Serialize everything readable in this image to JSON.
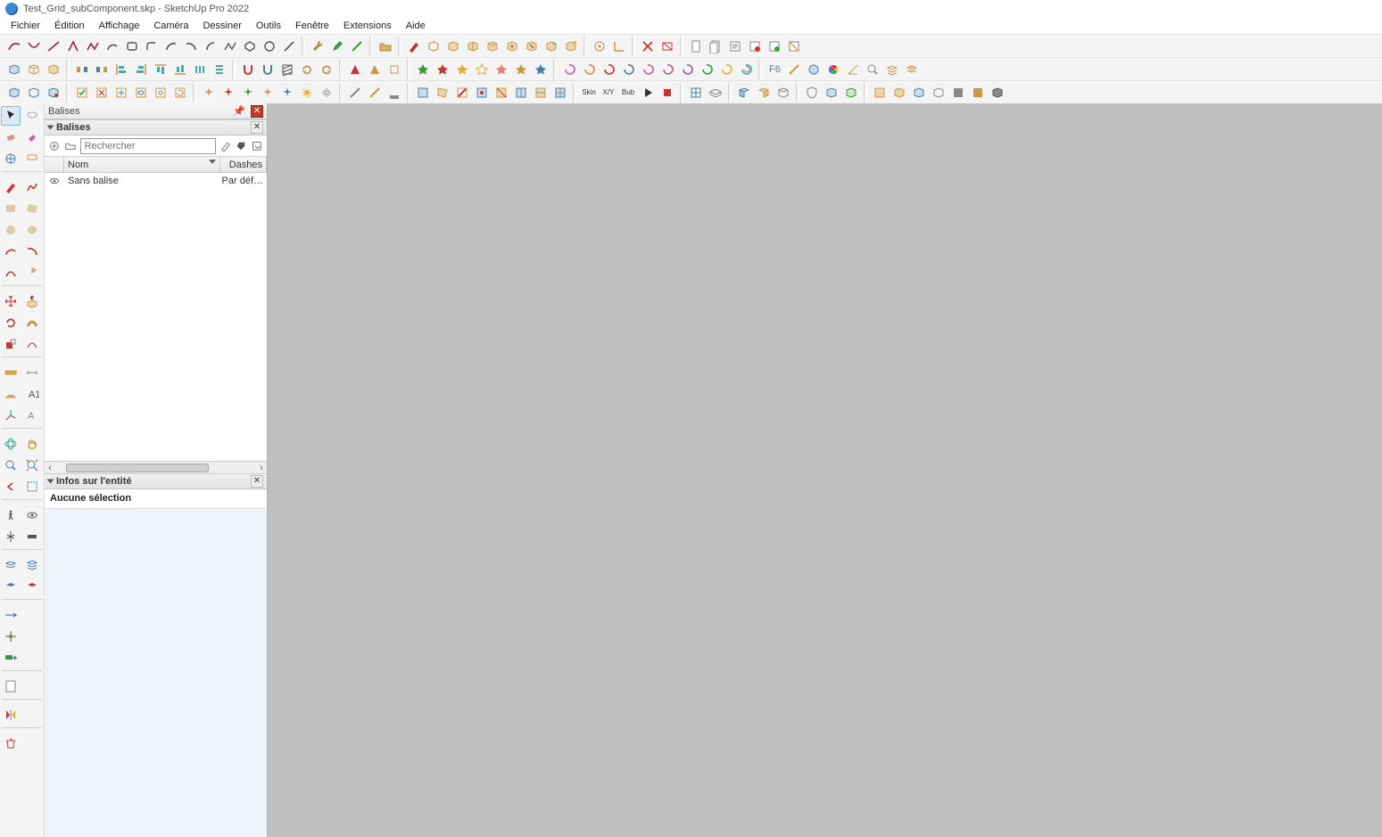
{
  "titlebar": {
    "title": "Test_Grid_subComponent.skp - SketchUp Pro 2022"
  },
  "menu": [
    "Fichier",
    "Édition",
    "Affichage",
    "Caméra",
    "Dessiner",
    "Outils",
    "Fenêtre",
    "Extensions",
    "Aide"
  ],
  "dock": {
    "title": "Balises"
  },
  "panels": {
    "tags": {
      "title": "Balises",
      "search_placeholder": "Rechercher",
      "cols": {
        "name": "Nom",
        "dashes": "Dashes"
      },
      "rows": [
        {
          "name": "Sans balise",
          "dashes": "Par déf…"
        }
      ]
    },
    "entity": {
      "title": "Infos sur l'entité",
      "body": "Aucune sélection"
    }
  },
  "tool_labels": {
    "skin": "Skin",
    "xy": "X/Y",
    "bub": "Bub"
  }
}
